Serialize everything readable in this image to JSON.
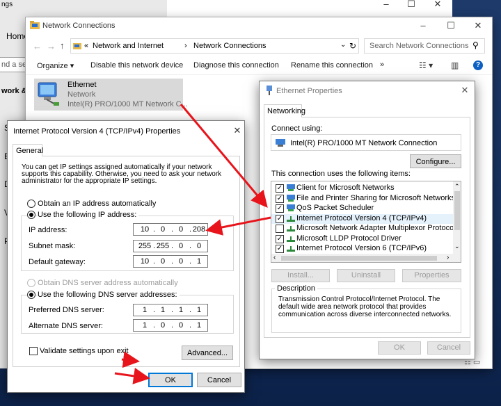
{
  "settings_window": {
    "title": "ngs",
    "home_label": "Home",
    "search_fragment": "nd a se",
    "network_fragment": "work &",
    "side_letters": [
      "S",
      "E",
      "D",
      "V",
      "P"
    ]
  },
  "nc_window": {
    "title": "Network Connections",
    "address": {
      "prefix": "«",
      "part1": "Network and Internet",
      "sep": "›",
      "part2": "Network Connections"
    },
    "search_placeholder": "Search Network Connections",
    "toolbar": {
      "organize": "Organize ▾",
      "disable": "Disable this network device",
      "diagnose": "Diagnose this connection",
      "rename": "Rename this connection",
      "more": "»"
    },
    "adapter": {
      "name": "Ethernet",
      "status": "Network",
      "device": "Intel(R) PRO/1000 MT Network C..."
    }
  },
  "eth_props": {
    "title": "Ethernet Properties",
    "tab": "Networking",
    "connect_using_label": "Connect using:",
    "adapter_name": "Intel(R) PRO/1000 MT Network Connection",
    "configure_label": "Configure...",
    "items_label": "This connection uses the following items:",
    "items": [
      {
        "label": "Client for Microsoft Networks",
        "checked": true,
        "icon": "network-client-icon"
      },
      {
        "label": "File and Printer Sharing for Microsoft Networks",
        "checked": true,
        "icon": "network-client-icon"
      },
      {
        "label": "QoS Packet Scheduler",
        "checked": true,
        "icon": "network-client-icon"
      },
      {
        "label": "Internet Protocol Version 4 (TCP/IPv4)",
        "checked": true,
        "icon": "protocol-icon"
      },
      {
        "label": "Microsoft Network Adapter Multiplexor Protocol",
        "checked": false,
        "icon": "protocol-icon"
      },
      {
        "label": "Microsoft LLDP Protocol Driver",
        "checked": true,
        "icon": "protocol-icon"
      },
      {
        "label": "Internet Protocol Version 6 (TCP/IPv6)",
        "checked": true,
        "icon": "protocol-icon"
      }
    ],
    "install_label": "Install...",
    "uninstall_label": "Uninstall",
    "properties_label": "Properties",
    "description_label": "Description",
    "description_text": "Transmission Control Protocol/Internet Protocol. The default wide area network protocol that provides communication across diverse interconnected networks.",
    "ok_label": "OK",
    "cancel_label": "Cancel"
  },
  "ipv4": {
    "title": "Internet Protocol Version 4 (TCP/IPv4) Properties",
    "tab": "General",
    "intro": "You can get IP settings assigned automatically if your network supports this capability. Otherwise, you need to ask your network administrator for the appropriate IP settings.",
    "obtain_ip_auto": "Obtain an IP address automatically",
    "use_ip": "Use the following IP address:",
    "ip_label": "IP address:",
    "ip_value": [
      "10",
      "0",
      "0",
      "208"
    ],
    "mask_label": "Subnet mask:",
    "mask_value": [
      "255",
      "255",
      "0",
      "0"
    ],
    "gateway_label": "Default gateway:",
    "gateway_value": [
      "10",
      "0",
      "0",
      "1"
    ],
    "obtain_dns_auto": "Obtain DNS server address automatically",
    "use_dns": "Use the following DNS server addresses:",
    "pref_dns_label": "Preferred DNS server:",
    "pref_dns_value": [
      "1",
      "1",
      "1",
      "1"
    ],
    "alt_dns_label": "Alternate DNS server:",
    "alt_dns_value": [
      "1",
      "0",
      "0",
      "1"
    ],
    "validate_label": "Validate settings upon exit",
    "advanced_label": "Advanced...",
    "ok_label": "OK",
    "cancel_label": "Cancel"
  },
  "colors": {
    "accent": "#0078d7",
    "arrow": "#e8141b"
  }
}
